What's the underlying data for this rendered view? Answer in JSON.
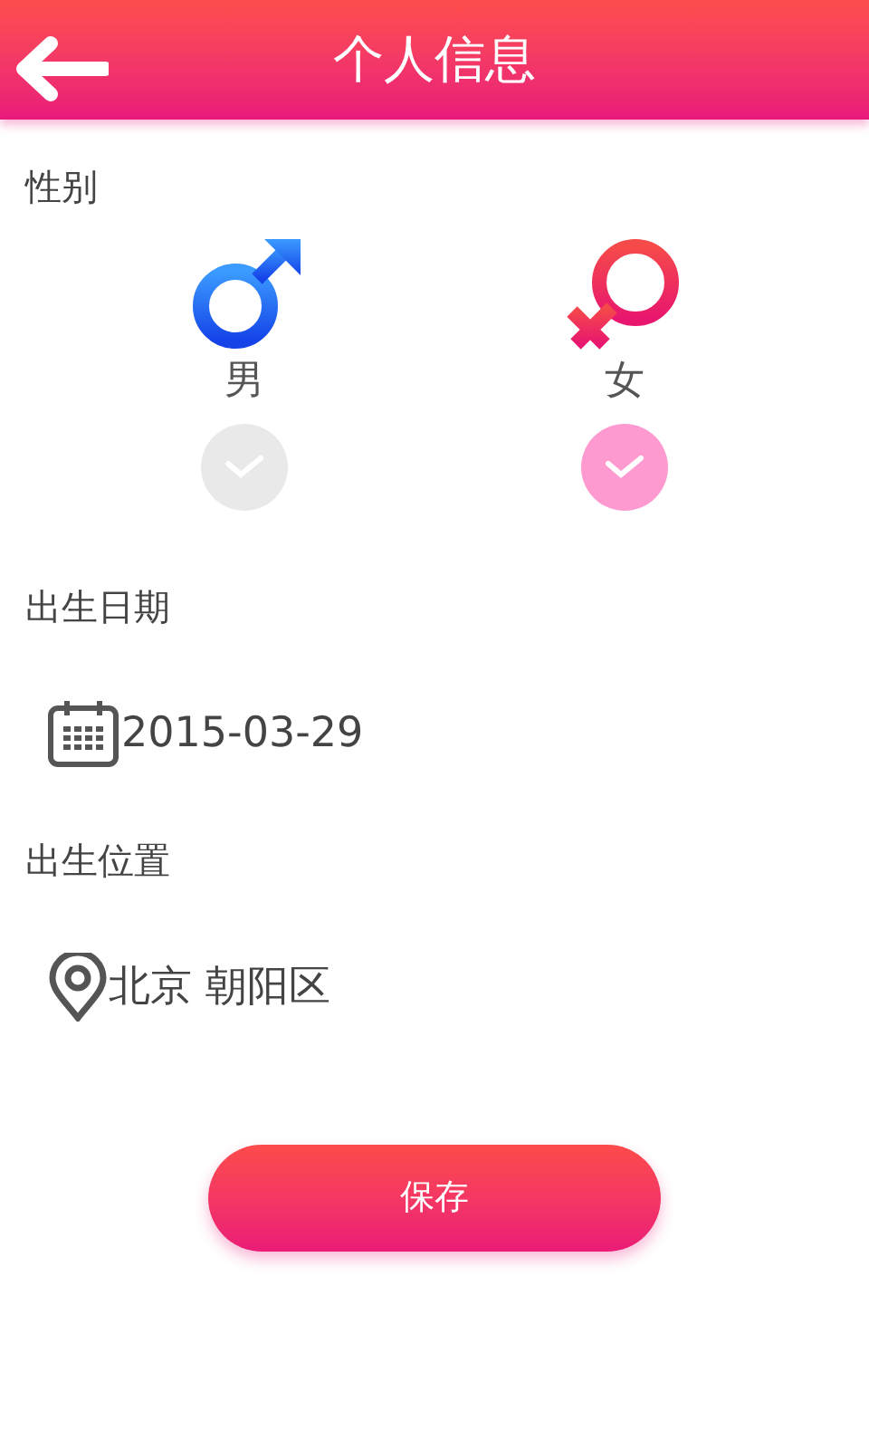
{
  "header": {
    "title": "个人信息"
  },
  "gender": {
    "label": "性别",
    "options": [
      {
        "kind": "male",
        "label": "男",
        "selected": false
      },
      {
        "kind": "female",
        "label": "女",
        "selected": true
      }
    ]
  },
  "birth_date": {
    "label": "出生日期",
    "value": "2015-03-29"
  },
  "birth_place": {
    "label": "出生位置",
    "value": "北京 朝阳区"
  },
  "save_button": {
    "label": "保存"
  }
}
